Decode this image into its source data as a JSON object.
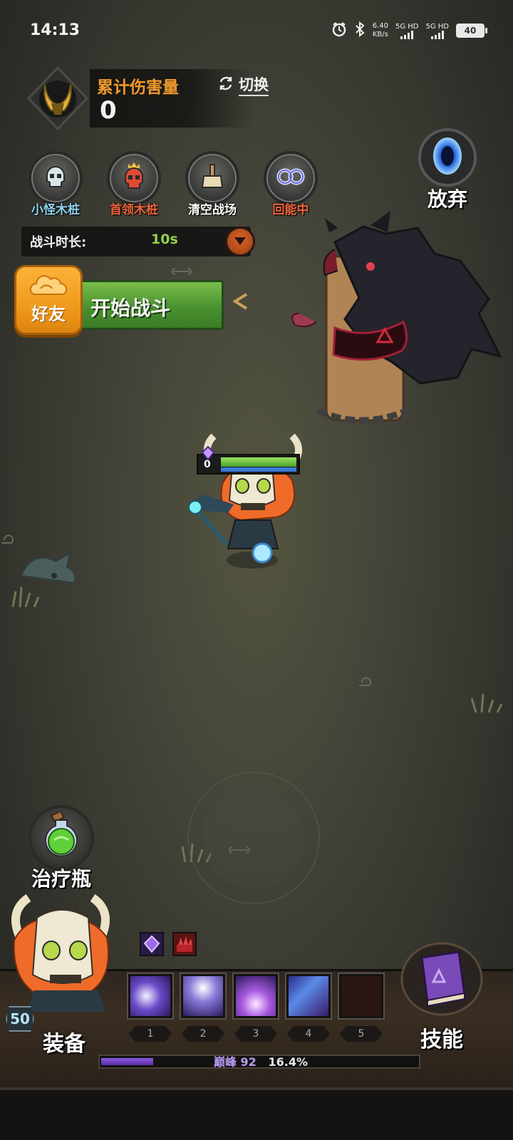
{
  "status_bar": {
    "time": "14:13",
    "net_speed_value": "6.40",
    "net_speed_unit": "KB/s",
    "sim1": "5G HD",
    "sim2": "5G HD",
    "battery": "40"
  },
  "damage_panel": {
    "title": "累计伤害量",
    "value": "0",
    "switch_label": "切换"
  },
  "tools": [
    {
      "label": "小怪木桩",
      "color": "#8fd3f0"
    },
    {
      "label": "首领木桩",
      "color": "#f0643c"
    },
    {
      "label": "清空战场",
      "color": "#ffffff"
    },
    {
      "label": "回能中",
      "color": "#f0643c"
    }
  ],
  "abandon_label": "放弃",
  "duration": {
    "label": "战斗时长:",
    "value": "10s"
  },
  "start_button_label": "开始战斗",
  "friend_button_label": "好友",
  "hero": {
    "shield": "0",
    "hp_fraction": 1.0
  },
  "heal_potion_label": "治疗瓶",
  "hud": {
    "level": "50",
    "equip_label": "装备",
    "skills_label": "技能",
    "slot_numbers": [
      "1",
      "2",
      "3",
      "4",
      "5"
    ],
    "exp_rank_label": "巅峰",
    "exp_rank_value": "92",
    "exp_percent": "16.4%",
    "exp_fraction": 0.164
  },
  "colors": {
    "accent_orange": "#f29a2c",
    "duration_green": "#8fd14f",
    "start_green": "#4a9230",
    "friend_orange": "#f19a1c",
    "exp_purple": "#7a48d0"
  }
}
